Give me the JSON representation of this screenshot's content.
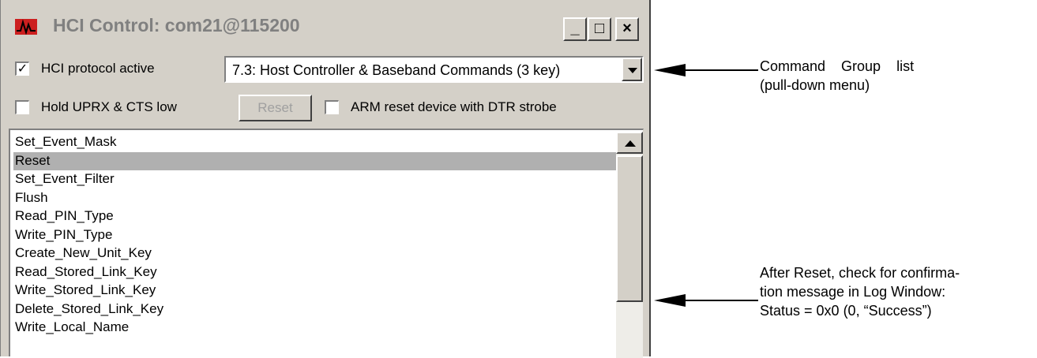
{
  "window": {
    "title": "HCI Control: com21@115200",
    "minimize_label": "_",
    "maximize_label": "□",
    "close_label": "×"
  },
  "options": {
    "protocol_active": {
      "label": "HCI protocol active",
      "checked": true,
      "mark": "✓"
    },
    "hold_uprx": {
      "label": "Hold UPRX & CTS low",
      "checked": false
    },
    "reset_button": "Reset",
    "arm_reset": {
      "label": "ARM reset device with DTR strobe",
      "checked": false
    }
  },
  "command_group": {
    "selected": "7.3: Host Controller & Baseband Commands (3 key)"
  },
  "commands": [
    "Set_Event_Mask",
    "Reset",
    "Set_Event_Filter",
    "Flush",
    "Read_PIN_Type",
    "Write_PIN_Type",
    "Create_New_Unit_Key",
    "Read_Stored_Link_Key",
    "Write_Stored_Link_Key",
    "Delete_Stored_Link_Key",
    "Write_Local_Name"
  ],
  "selected_command": "Reset",
  "annotations": {
    "group_line1": "Command    Group    list",
    "group_line2": "(pull-down menu)",
    "reset_line1": "After Reset, check for confirma-",
    "reset_line2": "tion message in Log Window:",
    "reset_line3": "Status = 0x0 (0, “Success”)"
  },
  "colors": {
    "window_bg": "#d4d0c8",
    "selection": "#b0b0b0",
    "icon_red": "#cc1f1f"
  },
  "icons": {
    "app": "signal-wave-icon",
    "dropdown": "chevron-down-icon",
    "scroll_up": "scroll-up-icon"
  }
}
